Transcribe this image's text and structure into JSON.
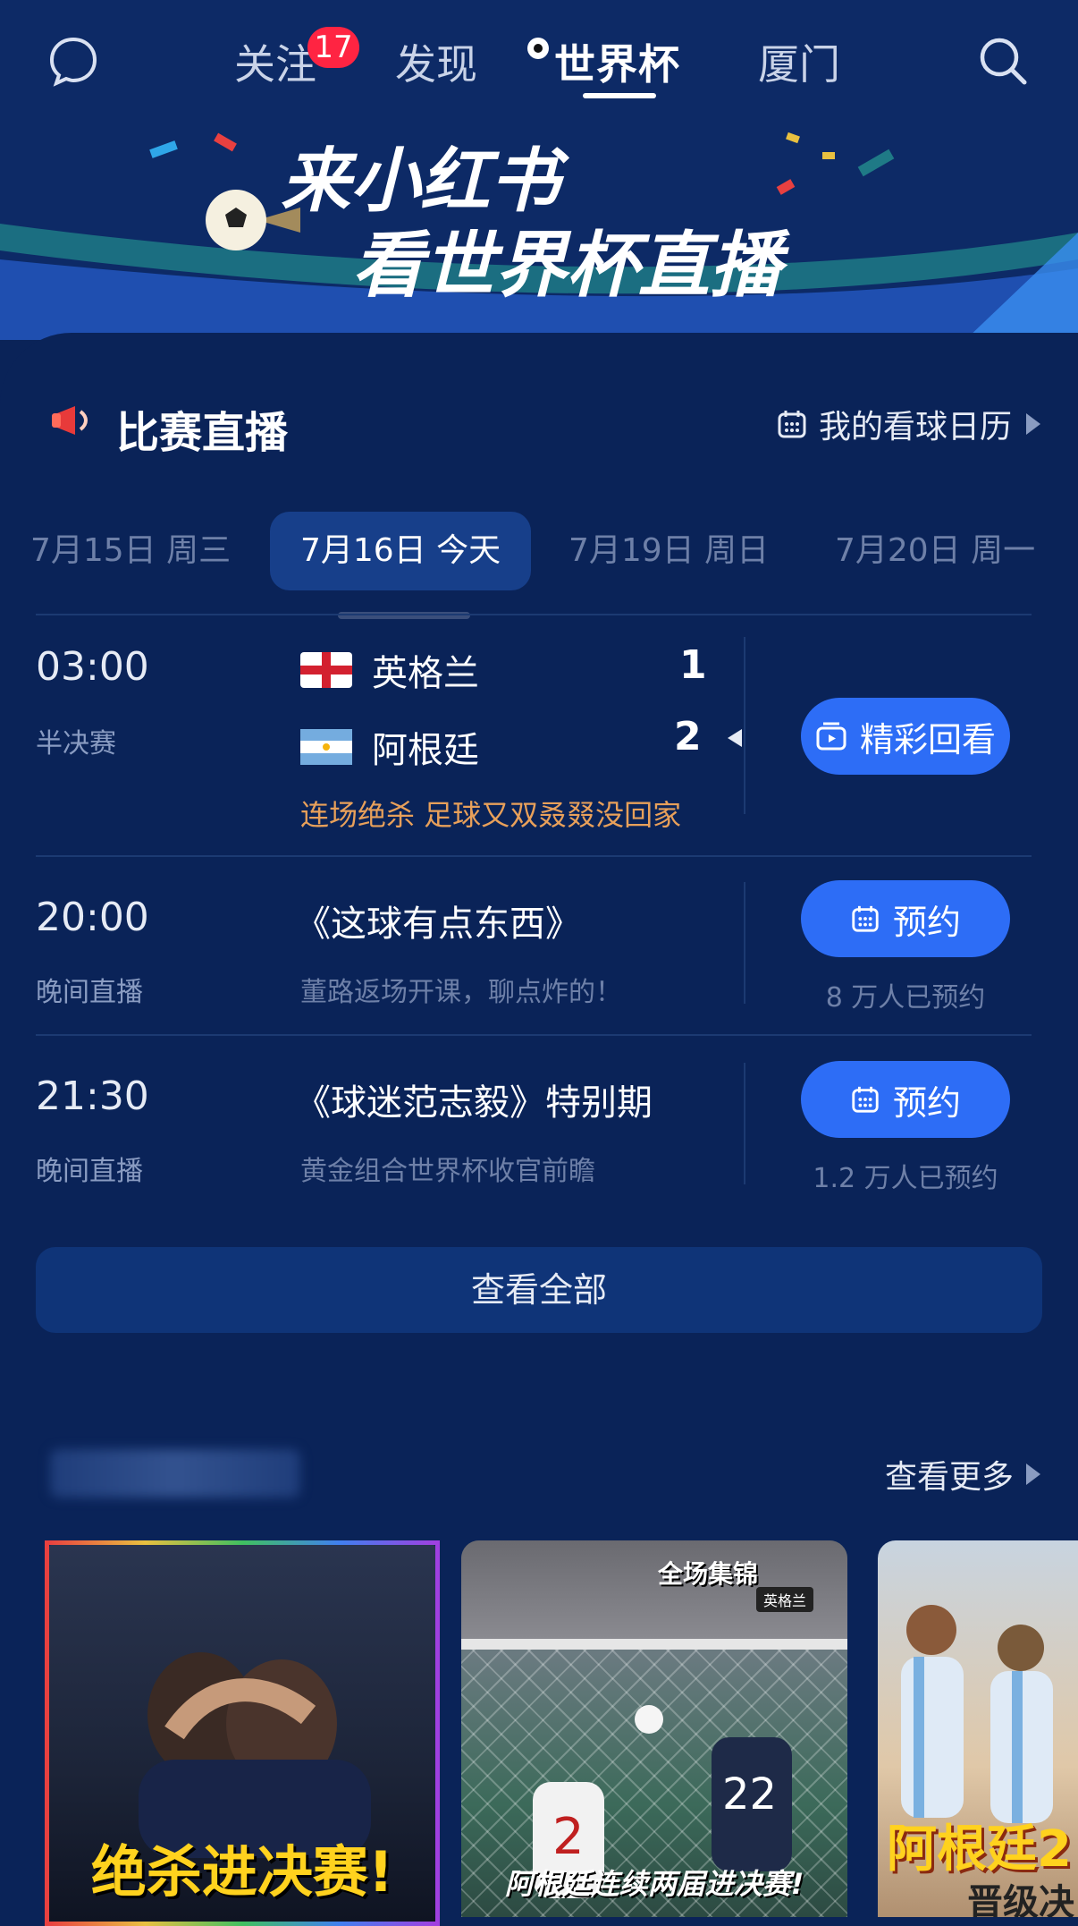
{
  "nav": {
    "tabs": [
      "关注",
      "发现",
      "世界杯",
      "厦门"
    ],
    "follow_badge": "17"
  },
  "banner": {
    "line1": "来小红书",
    "line2": "看世界杯直播"
  },
  "live": {
    "title": "比赛直播",
    "calendar_link": "我的看球日历",
    "dates": [
      "7月15日 周三",
      "7月16日 今天",
      "7月19日 周日",
      "7月20日 周一"
    ],
    "match": {
      "time": "03:00",
      "stage": "半决赛",
      "team1": "英格兰",
      "team2": "阿根廷",
      "score1": "1",
      "score2": "2",
      "highlight": "连场绝杀 足球又双叒叕没回家",
      "button": "精彩回看"
    },
    "programs": [
      {
        "time": "20:00",
        "type": "晚间直播",
        "title": "《这球有点东西》",
        "desc": "董路返场开课，聊点炸的！",
        "button": "预约",
        "count": "8 万人已预约"
      },
      {
        "time": "21:30",
        "type": "晚间直播",
        "title": "《球迷范志毅》特别期",
        "desc": "黄金组合世界杯收官前瞻",
        "button": "预约",
        "count": "1.2 万人已预约"
      }
    ],
    "view_all": "查看全部"
  },
  "more": {
    "see_more": "查看更多",
    "cards": [
      {
        "caption": "绝杀进决赛!"
      },
      {
        "caption": "阿根廷连续两届进决赛!",
        "tag": "全场集锦",
        "badge": "英格兰"
      },
      {
        "caption": "阿根廷2",
        "caption2": "晋级决"
      }
    ]
  },
  "colors": {
    "accent": "#2d6df6",
    "background": "#0a2358",
    "highlight": "#e8a05a",
    "badge": "#ff2442"
  }
}
